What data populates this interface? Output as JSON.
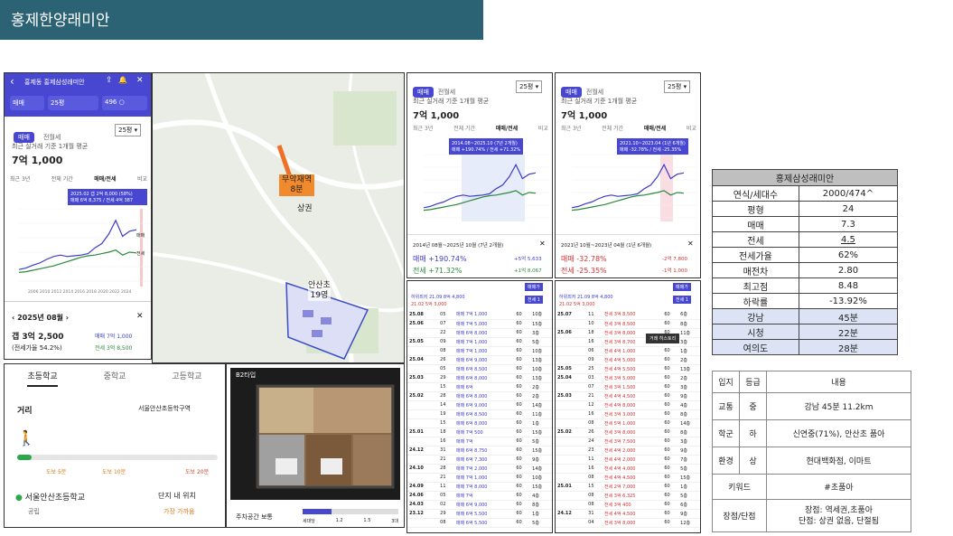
{
  "title": "홍제한양래미안",
  "app1": {
    "topbar": {
      "back": "‹",
      "title": "홍제동 홍제삼성래미안",
      "share": "⇪",
      "bell": "🔔",
      "close": "✕"
    },
    "filters": {
      "trade": "매매",
      "size": "25평",
      "price": "496 ○"
    },
    "tabs": [
      "매매",
      "전월세"
    ],
    "size_select": "25평 ▾",
    "avg_label": "최근 실거래 기준 1개월 평균",
    "avg_price": "7억 1,000",
    "period_tabs": [
      "최근 3년",
      "전체 기간",
      "매매/전세",
      "비교"
    ],
    "tooltip1": "2025.02  갭 2억 8,000 (58%)",
    "tooltip2": "매매 6억 8,375 / 전세 4억 387",
    "y_ticks": [
      "10억",
      "8억",
      "6억",
      "4억",
      "2억",
      "0",
      "전세가율"
    ],
    "legend_sale": "매매",
    "legend_lease": "전세",
    "x_ticks": "2006 2010 2012 2014 2016 2018 2020 2022 2024",
    "month_nav": {
      "prev": "‹",
      "month": "2025년 08월",
      "next": "›",
      "close": "✕"
    },
    "gap": "갭 3억 2,500",
    "gap_ratio": "(전세가율 54.2%)",
    "sale_row": "매매  7억 1,000",
    "lease_row": "전세  3억 8,500"
  },
  "map": {
    "station1": "무악재역",
    "station1_time": "8분",
    "market": "상권",
    "school": "안산초",
    "school_time": "19영"
  },
  "school_panel": {
    "tabs": [
      "초등학교",
      "중학교",
      "고등학교"
    ],
    "distance_label": "거리",
    "district": "서울안산초등학구역",
    "walk_labels": [
      "도보 5분",
      "도보 10분",
      "도보 20분"
    ],
    "school_name": "서울안산초등학교",
    "school_type": "공립",
    "position_label": "단지 내 위치",
    "position_value": "가장 가까움"
  },
  "floorplan": {
    "type_label": "B2타입",
    "parking_label": "주차공간 보통",
    "parking_scale": [
      "세대당",
      "1.2",
      "1.5",
      "3대"
    ]
  },
  "chart2": {
    "tabs": [
      "매매",
      "전월세"
    ],
    "size": "25평 ▾",
    "avg_label": "최근 실거래 기준 1개월 평균",
    "avg_price": "7억 1,000",
    "period_tabs": [
      "최근 3년",
      "전체 기간",
      "매매/전세",
      "비교"
    ],
    "tooltip1": "2014.08~2025.10 (7년 2개월)",
    "tooltip2": "매매 +190.74% / 전세 +71.32%",
    "range": "2014년 08월~2025년 10월 (7년 2개월)",
    "sale_pct": "+190.74%",
    "sale_abs": "+5억 5,633",
    "lease_pct": "+71.32%",
    "lease_abs": "+1억 8,067"
  },
  "chart3": {
    "tabs": [
      "매매",
      "전월세"
    ],
    "size": "25평 ▾",
    "avg_label": "최근 실거래 기준 1개월 평균",
    "avg_price": "7억 1,000",
    "period_tabs": [
      "최근 3년",
      "전체 기간",
      "매매/전세",
      "비교"
    ],
    "tooltip1": "2021.10~2023.04 (1년 6개월)",
    "tooltip2": "매매 -32.78% / 전세 -25.35%",
    "range": "2021년 10월~2023년 04월 (1년 6개월)",
    "sale_pct": "-32.78%",
    "sale_abs": "-2억 7,800",
    "lease_pct": "-25.35%",
    "lease_abs": "-1억 1,000"
  },
  "deals_left": {
    "header_row": "하위최저 21.09 8억 4,800",
    "header_row2": "21.02  5억 3,000",
    "cols": [
      "계약",
      "일",
      "층",
      "가격",
      "타입",
      "면적",
      "층"
    ],
    "rows": [
      [
        "25.08",
        "05",
        "매매 7억 1,000",
        "60",
        "10층"
      ],
      [
        "25.06",
        "07",
        "매매 7억 5,000",
        "60",
        "15층"
      ],
      [
        "",
        "22",
        "매매 6억 8,000",
        "60",
        "3층"
      ],
      [
        "25.05",
        "09",
        "매매 7억 1,000",
        "60",
        "5층"
      ],
      [
        "",
        "08",
        "매매 7억 1,000",
        "60",
        "10층"
      ],
      [
        "25.04",
        "26",
        "매매 6억 9,000",
        "60",
        "13층"
      ],
      [
        "",
        "05",
        "매매 6억 8,500",
        "60",
        "10층"
      ],
      [
        "25.03",
        "29",
        "매매 6억 8,000",
        "60",
        "13층"
      ],
      [
        "",
        "15",
        "매매 6억",
        "60",
        "2층"
      ],
      [
        "25.02",
        "28",
        "매매 6억 8,000",
        "60",
        "2층"
      ],
      [
        "",
        "14",
        "매매 6억 9,000",
        "60",
        "14층"
      ],
      [
        "",
        "19",
        "매매 6억 8,500",
        "60",
        "11층"
      ],
      [
        "",
        "15",
        "매매 6억 8,000",
        "60",
        "1층"
      ],
      [
        "25.01",
        "18",
        "매매 7억 500",
        "60",
        "15층"
      ],
      [
        "",
        "16",
        "매매 7억",
        "60",
        "5층"
      ],
      [
        "24.12",
        "31",
        "매매 6억 8,750",
        "60",
        "15층"
      ],
      [
        "",
        "21",
        "매매 6억 7,300",
        "60",
        "9층"
      ],
      [
        "24.10",
        "28",
        "매매 7억 2,000",
        "60",
        "14층"
      ],
      [
        "",
        "21",
        "매매 7억 1,000",
        "60",
        "10층"
      ],
      [
        "24.09",
        "11",
        "매매 7억 8,000",
        "60",
        "15층"
      ],
      [
        "24.06",
        "05",
        "매매 7억",
        "60",
        "4층"
      ],
      [
        "24.03",
        "02",
        "매매 6억 9,000",
        "60",
        "8층"
      ],
      [
        "23.12",
        "29",
        "매매 6억 5,500",
        "60",
        "1층"
      ],
      [
        "",
        "08",
        "매매 6억 5,500",
        "60",
        "5층"
      ]
    ]
  },
  "deals_right": {
    "header_row": "하위최저 21.09 8억 4,800",
    "header_row2": "21.02  5억 3,000",
    "rows": [
      [
        "25.07",
        "11",
        "전세 3억 8,500",
        "60",
        "6층"
      ],
      [
        "",
        "10",
        "전세 3억 8,500",
        "60",
        "8층"
      ],
      [
        "25.06",
        "18",
        "전세 3억 8,000",
        "60",
        "11층"
      ],
      [
        "",
        "16",
        "전세 3억 8,700",
        "60",
        "3층"
      ],
      [
        "",
        "06",
        "전세 4억 1,000",
        "60",
        "1층"
      ],
      [
        "",
        "09",
        "전세 4억 5,000",
        "60",
        "2층"
      ],
      [
        "25.05",
        "25",
        "전세 4억 5,500",
        "60",
        "13층"
      ],
      [
        "25.04",
        "03",
        "전세 3억 5,000",
        "60",
        "2층"
      ],
      [
        "",
        "07",
        "전세 3억 1,500",
        "60",
        "3층"
      ],
      [
        "25.03",
        "21",
        "전세 4억 4,500",
        "60",
        "9층"
      ],
      [
        "",
        "12",
        "전세 4억 8,000",
        "60",
        "4층"
      ],
      [
        "",
        "16",
        "전세 3억 3,000",
        "60",
        "8층"
      ],
      [
        "",
        "08",
        "전세 5억 1,000",
        "60",
        "14층"
      ],
      [
        "25.02",
        "26",
        "전세 3억 8,000",
        "60",
        "8층"
      ],
      [
        "",
        "24",
        "전세 3억 7,500",
        "60",
        "3층"
      ],
      [
        "",
        "23",
        "전세 4억 2,000",
        "60",
        "9층"
      ],
      [
        "",
        "11",
        "전세 4억 2,000",
        "60",
        "7층"
      ],
      [
        "",
        "16",
        "전세 4억 4,000",
        "60",
        "5층"
      ],
      [
        "",
        "08",
        "전세 4억 4,500",
        "60",
        "15층"
      ],
      [
        "25.01",
        "15",
        "전세 2억 7,000",
        "60",
        "1층"
      ],
      [
        "",
        "08",
        "전세 3억 6,325",
        "60",
        "5층"
      ],
      [
        "",
        "08",
        "전세 3억 400",
        "60",
        "6층"
      ],
      [
        "24.12",
        "31",
        "전세 4억 4,500",
        "60",
        "9층"
      ],
      [
        "",
        "04",
        "전세 3억 8,000",
        "60",
        "12층"
      ]
    ],
    "tooltip": "거래 히스토리"
  },
  "summary": {
    "title": "홍제삼성래미안",
    "rows": [
      [
        "연식/세대수",
        "2000/474^"
      ],
      [
        "평형",
        "24"
      ],
      [
        "매매",
        "7.3"
      ],
      [
        "전세",
        "4.5"
      ],
      [
        "전세가율",
        "62%"
      ],
      [
        "매전차",
        "2.80"
      ],
      [
        "최고점",
        "8.48"
      ],
      [
        "하락률",
        "-13.92%"
      ],
      [
        "강남",
        "45분"
      ],
      [
        "시청",
        "22분"
      ],
      [
        "여의도",
        "28분"
      ]
    ]
  },
  "eval": {
    "headers": [
      "입지",
      "등급",
      "내용"
    ],
    "rows": [
      [
        "교통",
        "중",
        "강남 45분 11.2km"
      ],
      [
        "학군",
        "하",
        "신연중(71%), 안산초 품아"
      ],
      [
        "환경",
        "상",
        "현대백화점, 이마트"
      ]
    ],
    "keyword_label": "키워드",
    "keyword_value": "#초품아",
    "pros_label": "장점/단점",
    "pros_value": "장점: 역세권,초품아",
    "cons_value": "단점: 상권 없음, 단절됨"
  },
  "chart_data": {
    "type": "line",
    "series": [
      {
        "name": "매매",
        "values": [
          1.6,
          1.8,
          2.2,
          2.5,
          3.0,
          3.4,
          3.6,
          3.4,
          3.5,
          3.6,
          3.8,
          4.6,
          5.2,
          6.5,
          8.4,
          6.2,
          6.9,
          7.1
        ]
      },
      {
        "name": "전세",
        "values": [
          1.2,
          1.3,
          1.5,
          1.7,
          1.9,
          2.1,
          2.4,
          2.7,
          3.0,
          3.3,
          3.5,
          3.6,
          3.8,
          4.0,
          4.3,
          3.6,
          4.0,
          3.9
        ]
      }
    ],
    "x": [
      2006,
      2007,
      2008,
      2009,
      2010,
      2011,
      2012,
      2013,
      2014,
      2015,
      2016,
      2017,
      2018,
      2019,
      2021,
      2023,
      2024,
      2025
    ],
    "ylim": [
      0,
      10
    ]
  }
}
